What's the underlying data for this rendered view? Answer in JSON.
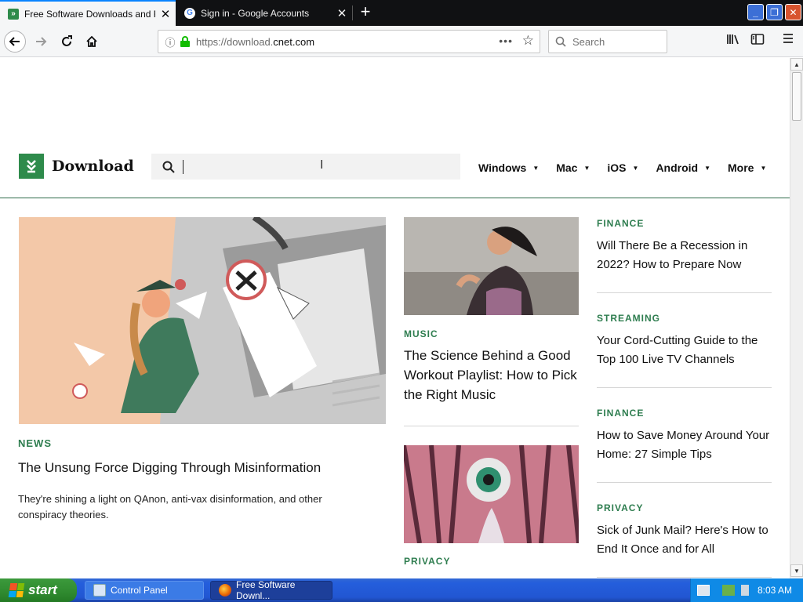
{
  "browser": {
    "tabs": [
      {
        "title": "Free Software Downloads and Re",
        "favicon": "download-favicon",
        "active": true
      },
      {
        "title": "Sign in - Google Accounts",
        "favicon": "google-favicon",
        "active": false
      }
    ],
    "url": {
      "scheme_host": "https://download.",
      "domain": "cnet.com"
    },
    "search_placeholder": "Search",
    "new_tab_label": "+"
  },
  "site": {
    "logo_text": "Download",
    "nav": [
      {
        "label": "Windows"
      },
      {
        "label": "Mac"
      },
      {
        "label": "iOS"
      },
      {
        "label": "Android"
      },
      {
        "label": "More"
      }
    ]
  },
  "hero": {
    "category": "NEWS",
    "title": "The Unsung Force Digging Through Misinformation",
    "description": "They're shining a light on QAnon, anti-vax disinformation, and other conspiracy theories."
  },
  "middle": [
    {
      "category": "MUSIC",
      "title": "The Science Behind a Good Workout Playlist: How to Pick the Right Music"
    },
    {
      "category": "PRIVACY"
    }
  ],
  "right": [
    {
      "category": "FINANCE",
      "title": "Will There Be a Recession in 2022? How to Prepare Now"
    },
    {
      "category": "STREAMING",
      "title": "Your Cord-Cutting Guide to the Top 100 Live TV Channels"
    },
    {
      "category": "FINANCE",
      "title": "How to Save Money Around Your Home: 27 Simple Tips"
    },
    {
      "category": "PRIVACY",
      "title": "Sick of Junk Mail? Here's How to End It Once and for All"
    }
  ],
  "taskbar": {
    "start_label": "start",
    "buttons": [
      {
        "label": "Control Panel"
      },
      {
        "label": "Free Software Downl..."
      }
    ],
    "clock": "8:03 AM"
  },
  "colors": {
    "accent": "#2e8b4b",
    "category": "#2e7d4f",
    "tab_highlight": "#0a84ff"
  }
}
